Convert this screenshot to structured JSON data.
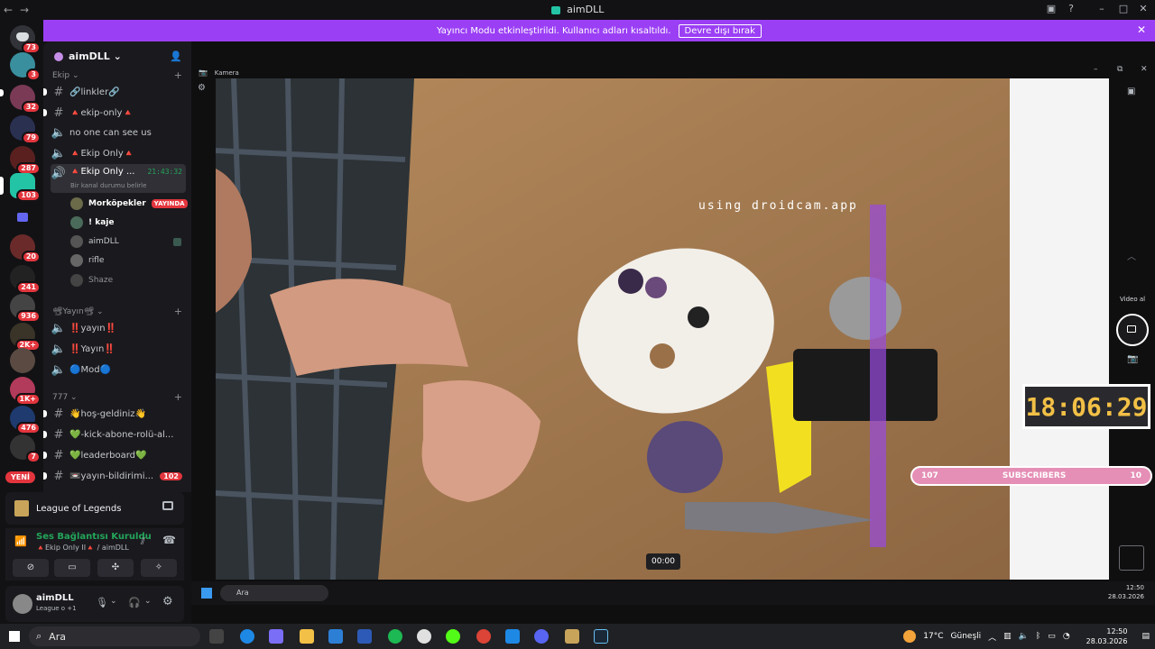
{
  "app": {
    "title": "aimDLL"
  },
  "banner": {
    "text": "Yayıncı Modu etkinleştirildi. Kullanıcı adları kısaltıldı.",
    "button": "Devre dışı bırak"
  },
  "rail": {
    "badges": [
      "73",
      "3",
      "32",
      "79",
      "287",
      "103",
      "20",
      "241",
      "936",
      "2K+",
      "1K+",
      "476",
      "7"
    ],
    "new_label": "YENİ"
  },
  "sidebar": {
    "server_name": "aimDLL",
    "categories": [
      "Ekip",
      "Yayın",
      "777"
    ],
    "channels": [
      {
        "label": "🔗linkler🔗"
      },
      {
        "label": "🔺ekip-only🔺"
      },
      {
        "label": "no one can see us"
      },
      {
        "label": "🔺Ekip Only🔺"
      },
      {
        "label": "🔺Ekip Only ...",
        "time": "21:43:32",
        "status": "Bir kanal durumu belirle"
      },
      {
        "label": "‼️yayın‼️"
      },
      {
        "label": "‼️Yayın‼️"
      },
      {
        "label": "🔵Mod🔵"
      },
      {
        "label": "👋hoş-geldiniz👋"
      },
      {
        "label": "💚-kick-abone-rolü-al..."
      },
      {
        "label": "💚leaderboard💚"
      },
      {
        "label": "📼yayın-bildirimi...",
        "mention": "102"
      }
    ],
    "voice_users": [
      {
        "name": "Morköpekler",
        "live": "YAYINDA"
      },
      {
        "name": "! kaje"
      },
      {
        "name": "aimDLL"
      },
      {
        "name": "rifle"
      },
      {
        "name": "Shaze"
      }
    ]
  },
  "activity": {
    "game": "League of Legends"
  },
  "voice": {
    "status": "Ses Bağlantısı Kuruldu",
    "channel": "🔺Ekip Only II🔺 / aimDLL"
  },
  "user": {
    "name": "aimDLL",
    "status": "League o +1"
  },
  "camera": {
    "window_title": "Kamera",
    "watermark": "using droidcam.app",
    "timer": "00:00",
    "video_label": "Video al"
  },
  "overlay": {
    "clock": "18:06:29",
    "subs_left": "107",
    "subs_label": "SUBSCRIBERS",
    "subs_right": "10"
  },
  "inner_taskbar": {
    "search": "Ara",
    "time": "12:50",
    "date": "28.03.2026"
  },
  "taskbar": {
    "search": "Ara",
    "weather_temp": "17°C",
    "weather_text": "Güneşli",
    "time": "12:50",
    "date": "28.03.2026"
  },
  "colors": {
    "accent": "#9b3ff5",
    "danger": "#e3353d",
    "online": "#23a55a"
  }
}
